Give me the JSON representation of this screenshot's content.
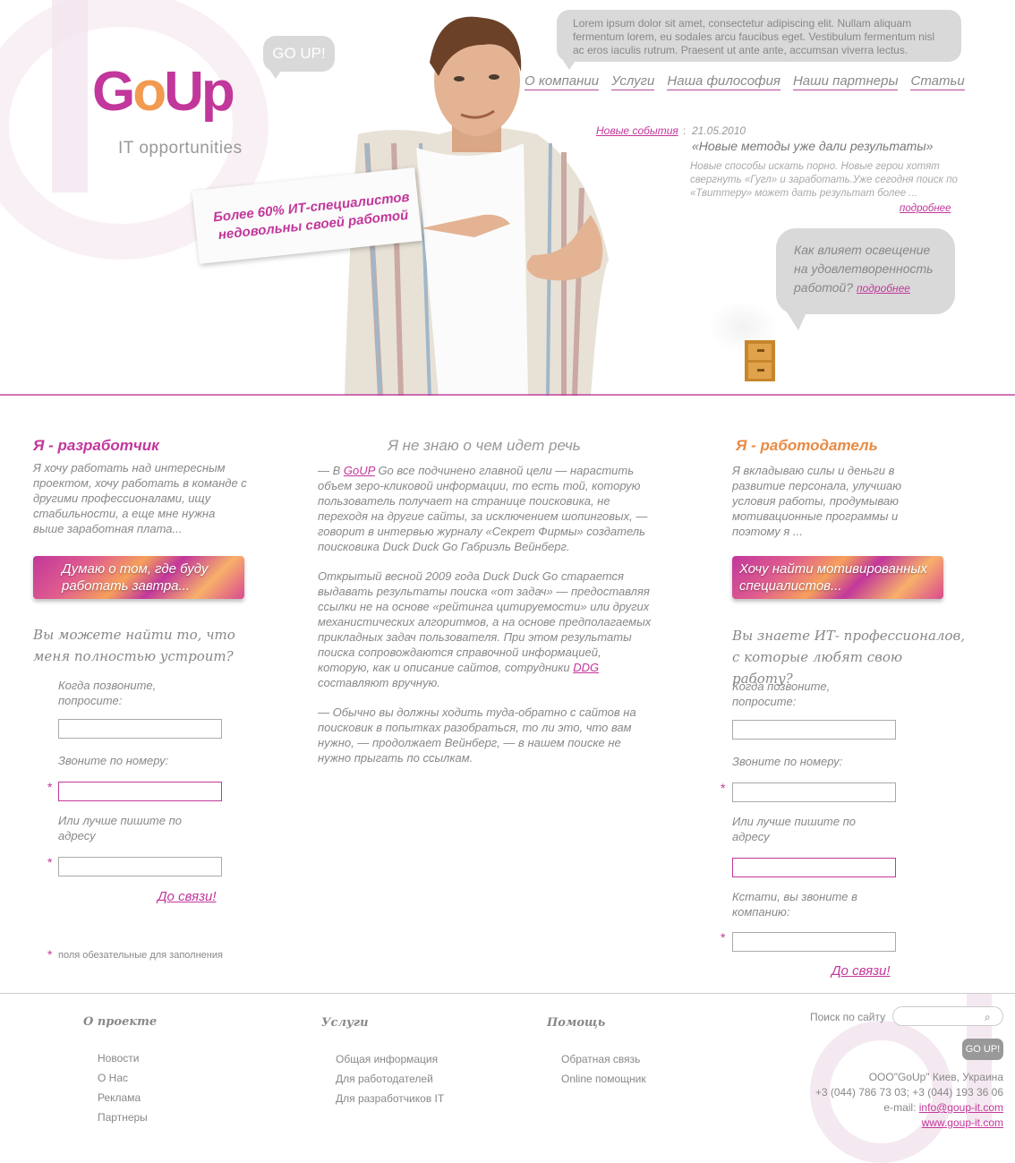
{
  "colors": {
    "brand_magenta": "#c2379b",
    "brand_orange": "#f29a4f",
    "bubble_grey": "#d9d9d9"
  },
  "header": {
    "logo_text": "GoUp",
    "logo_subtitle": "IT opportunities",
    "goup_bubble": "GO UP!",
    "top_bubble_text": "Lorem ipsum dolor sit amet, consectetur adipiscing elit. Nullam aliquam fermentum lorem, eu sodales arcu faucibus eget. Vestibulum fermentum nisl ac eros iaculis rutrum. Praesent ut ante ante, accumsan viverra lectus.",
    "nav": [
      "О компании",
      "Услуги",
      "Наша философия",
      "Наши партнеры",
      "Статьи"
    ],
    "sign_text": "Более 60% ИТ-специалистов недовольны своей работой",
    "news": {
      "label": "Новые события",
      "date": "21.05.2010",
      "title": "«Новые методы уже дали результаты»",
      "text": "Новые способы искать порно. Новые герои хотят свергнуть «Гугл» и заработать.Уже сегодня поиск по «Твиттеру» может дать результат более ...",
      "more": "подробнее"
    },
    "question": {
      "text": "Как влияет освещение на удовлетворенность работой?",
      "more": "подробнее"
    }
  },
  "left": {
    "heading": "Я - разработчик",
    "text": "Я хочу работать над интересным проектом, хочу работать в команде с другими профессионалами, ищу стабильности, а еще мне нужна выше заработная плата...",
    "cta": "Думаю о том, где буду работать завтра...",
    "form_heading": "Вы можете найти то, что меня полностью устроит?",
    "label_when": "Когда позвоните, попросите:",
    "label_phone": "Звоните по номеру:",
    "label_address": "Или лучше пишите по адресу",
    "submit": "До связи!",
    "required_note": "поля обезательные для заполнения"
  },
  "middle": {
    "heading": "Я не знаю о чем идет речь",
    "p1_a": "— В ",
    "p1_link": "GoUP",
    "p1_b": " Go все подчинено главной цели — нарастить объем зеро-кликовой информации, то есть той, которую пользователь получает на странице поисковика, не переходя на другие сайты, за исключением шопинговых, — говорит в интервью журналу «Секрет Фирмы» создатель поисковика Duck Duck Go Габриэль Вейнберг.",
    "p2_a": "Открытый весной 2009 года Duck Duck Go старается выдавать результаты поиска «от задач» — предоставляя ссылки не на основе «рейтинга цитируемости» или других механистических алгоритмов, а на основе предполагаемых прикладных задач пользователя. При этом результаты поиска сопровождаются справочной информацией, которую, как и описание сайтов, сотрудники ",
    "p2_link": "DDG",
    "p2_b": " составляют вручную.",
    "p3": "— Обычно вы должны ходить туда-обратно с сайтов на поисковик в попытках разобраться, то ли это, что вам нужно, — продолжает Вейнберг, — в нашем поиске не нужно прыгать по ссылкам."
  },
  "right": {
    "heading": "Я - работодатель",
    "text": "Я вкладываю силы и деньги в развитие персонала, улучшаю условия работы, продумываю мотивационные программы и поэтому я ...",
    "cta": "Хочу найти мотивированных специалистов...",
    "form_heading": "Вы знаете ИТ- профессионалов, с которые любят свою работу?",
    "label_when": "Когда позвоните, попросите:",
    "label_phone": "Звоните по номеру:",
    "label_address": "Или лучше пишите по адресу",
    "label_company": "Кстати, вы звоните в компанию:",
    "submit": "До связи!"
  },
  "footer": {
    "col1": {
      "heading": "О проекте",
      "items": [
        "Новости",
        "О Нас",
        "Реклама",
        "Партнеры"
      ]
    },
    "col2": {
      "heading": "Услуги",
      "items": [
        "Общая информация",
        "Для работодателей",
        "Для разработчиков IT"
      ]
    },
    "col3": {
      "heading": "Помощь",
      "items": [
        "Обратная связь",
        "Online помощник"
      ]
    },
    "search_label": "Поиск по сайту",
    "go_button": "GO UP!",
    "company": "ООО\"GoUp\" Киев, Украина",
    "phones": "+3 (044) 786 73 03; +3 (044) 193 36 06",
    "email_label": "e-mail: ",
    "email": "info@goup-it.com",
    "site": "www.goup-it.com"
  }
}
